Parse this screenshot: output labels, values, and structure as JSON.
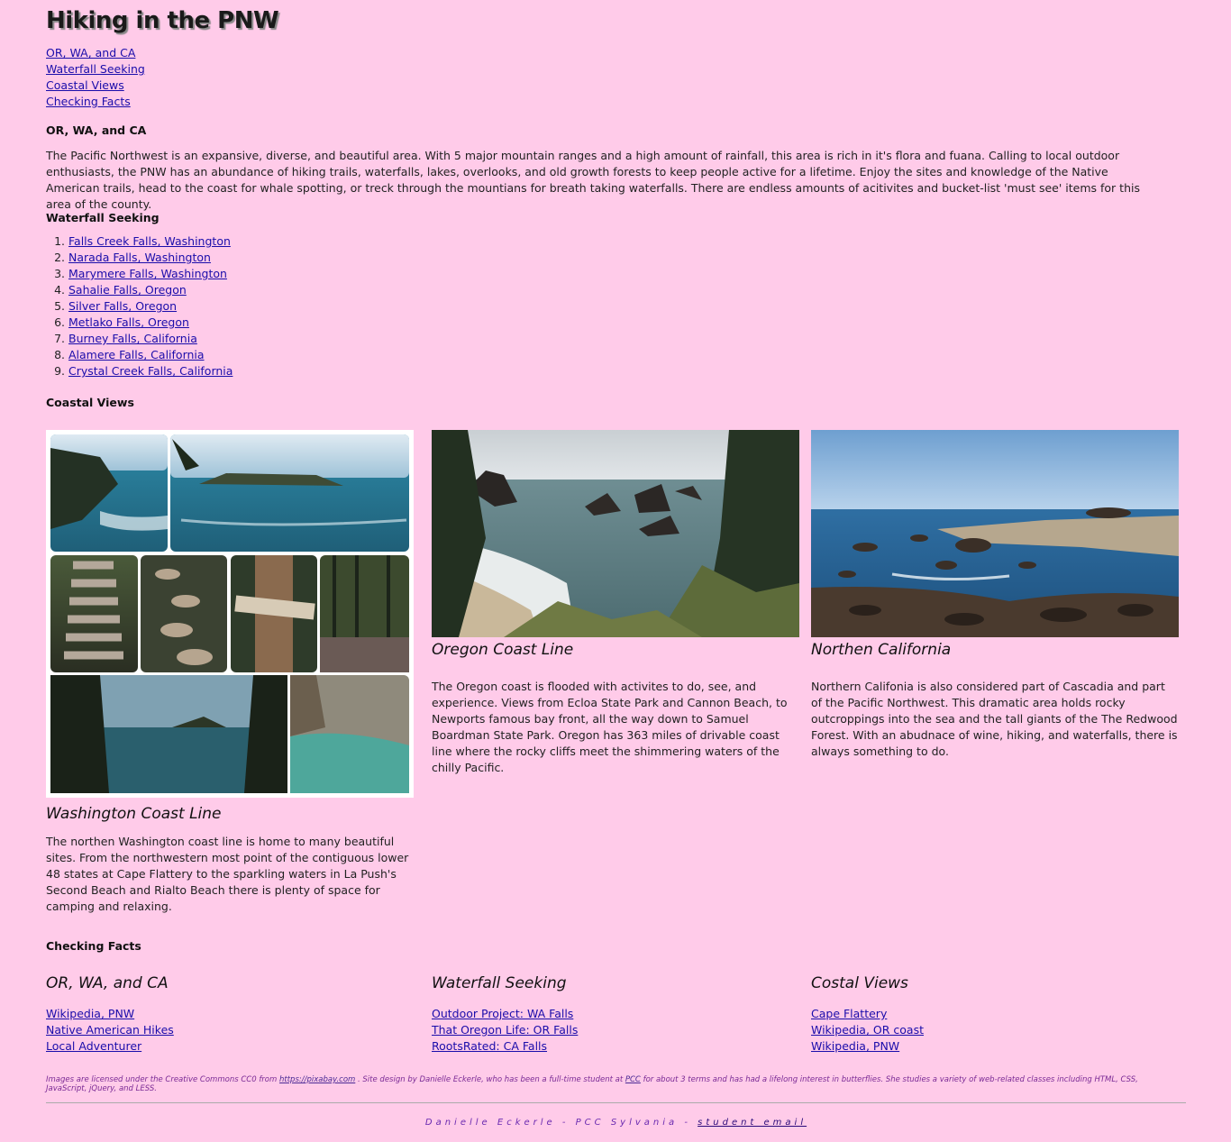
{
  "header": {
    "title": "Hiking in the PNW"
  },
  "nav": {
    "links": [
      "OR, WA, and CA",
      "Waterfall Seeking",
      "Coastal Views",
      "Checking Facts"
    ]
  },
  "intro": {
    "heading": "OR, WA, and CA",
    "body": "The Pacific Northwest is an expansive, diverse, and beautiful area. With 5 major mountain ranges and a high amount of rainfall, this area is rich in it's flora and fuana. Calling to local outdoor enthusiasts, the PNW has an abundance of hiking trails, waterfalls, lakes, overlooks, and old growth forests to keep people active for a lifetime. Enjoy the sites and knowledge of the Native American trails, head to the coast for whale spotting, or treck through the mountians for breath taking waterfalls. There are endless amounts of acitivites and bucket-list 'must see' items for this area of the county."
  },
  "waterfalls": {
    "heading": "Waterfall Seeking",
    "items": [
      "Falls Creek Falls, Washington",
      "Narada Falls, Washington",
      "Marymere Falls, Washington",
      "Sahalie Falls, Oregon",
      "Silver Falls, Oregon",
      "Metlako Falls, Oregon",
      "Burney Falls, California",
      "Alamere Falls, California",
      "Crystal Creek Falls, California"
    ]
  },
  "coastal": {
    "heading": "Coastal Views",
    "cards": [
      {
        "title": "Washington Coast Line",
        "body": "The northen Washington coast line is home to many beautiful sites. From the northwestern most point of the contiguous lower 48 states at Cape Flattery to the sparkling waters in La Push's Second Beach and Rialto Beach there is plenty of space for camping and relaxing."
      },
      {
        "title": "Oregon Coast Line",
        "body": "The Oregon coast is flooded with activites to do, see, and experience. Views from Ecloa State Park and Cannon Beach, to Newports famous bay front, all the way down to Samuel Boardman State Park. Oregon has 363 miles of drivable coast line where the rocky cliffs meet the shimmering waters of the chilly Pacific."
      },
      {
        "title": "Northen California",
        "body": "Northern Califonia is also considered part of Cascadia and part of the Pacific Northwest. This dramatic area holds rocky outcroppings into the sea and the tall giants of the The Redwood Forest. With an abudnace of wine, hiking, and waterfalls, there is always something to do."
      }
    ]
  },
  "facts": {
    "heading": "Checking Facts",
    "columns": [
      {
        "title": "OR, WA, and CA",
        "links": [
          "Wikipedia, PNW",
          "Native American Hikes",
          "Local Adventurer"
        ]
      },
      {
        "title": "Waterfall Seeking",
        "links": [
          "Outdoor Project: WA Falls",
          "That Oregon Life: OR Falls",
          "RootsRated: CA Falls"
        ]
      },
      {
        "title": "Costal Views",
        "links": [
          "Cape Flattery",
          "Wikipedia, OR coast",
          "Wikipedia, PNW"
        ]
      }
    ]
  },
  "footer": {
    "note_prefix": "Images are licensed under the Creative Commons CC0 from ",
    "note_link": "https://pixabay.com",
    "note_mid": " . Site design by Danielle Eckerle, who has been a full-time student at ",
    "note_pcc": "PCC",
    "note_suffix": " for about 3 terms and has had a lifelong interest in butterflies. She studies a variety of web-related classes including HTML, CSS, JavaScript, jQuery, and LESS.",
    "signature_text": "Danielle Eckerle - PCC Sylvania - ",
    "signature_link": "student email"
  },
  "colors": {
    "background": "#ffcbe9",
    "link": "#1a0dab",
    "footer_text": "#7a2a95"
  }
}
